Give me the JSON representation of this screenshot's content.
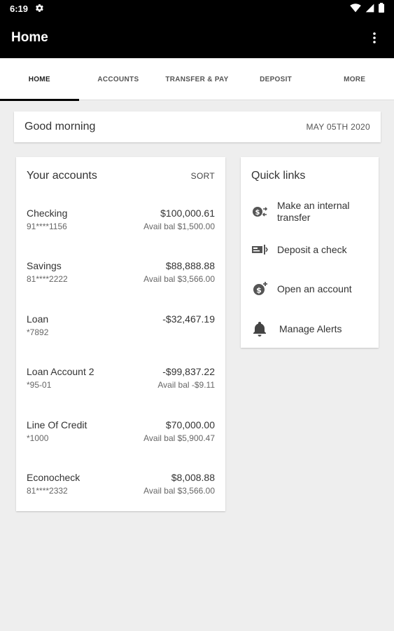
{
  "status_bar": {
    "time": "6:19"
  },
  "app_bar": {
    "title": "Home"
  },
  "tabs": [
    {
      "label": "HOME",
      "active": true
    },
    {
      "label": "ACCOUNTS",
      "active": false
    },
    {
      "label": "TRANSFER & PAY",
      "active": false
    },
    {
      "label": "DEPOSIT",
      "active": false
    },
    {
      "label": "MORE",
      "active": false
    }
  ],
  "greeting": {
    "text": "Good morning",
    "date": "MAY 05TH 2020"
  },
  "accounts": {
    "title": "Your accounts",
    "sort_label": "SORT",
    "items": [
      {
        "name": "Checking",
        "number": "91****1156",
        "balance": "$100,000.61",
        "avail": "Avail bal $1,500.00"
      },
      {
        "name": "Savings",
        "number": "81****2222",
        "balance": "$88,888.88",
        "avail": "Avail bal $3,566.00"
      },
      {
        "name": "Loan",
        "number": "*7892",
        "balance": "-$32,467.19",
        "avail": ""
      },
      {
        "name": "Loan Account 2",
        "number": "*95-01",
        "balance": "-$99,837.22",
        "avail": "Avail bal -$9.11"
      },
      {
        "name": "Line Of Credit",
        "number": "*1000",
        "balance": "$70,000.00",
        "avail": "Avail bal $5,900.47"
      },
      {
        "name": "Econocheck",
        "number": "81****2332",
        "balance": "$8,008.88",
        "avail": "Avail bal $3,566.00"
      }
    ]
  },
  "quick_links": {
    "title": "Quick links",
    "items": [
      {
        "label": "Make an internal transfer",
        "icon": "transfer-icon"
      },
      {
        "label": "Deposit a check",
        "icon": "check-deposit-icon"
      },
      {
        "label": "Open an account",
        "icon": "open-account-icon"
      },
      {
        "label": "Manage Alerts",
        "icon": "bell-icon"
      }
    ]
  },
  "colors": {
    "app_bar": "#000000",
    "background": "#eeeeee",
    "card": "#ffffff"
  }
}
